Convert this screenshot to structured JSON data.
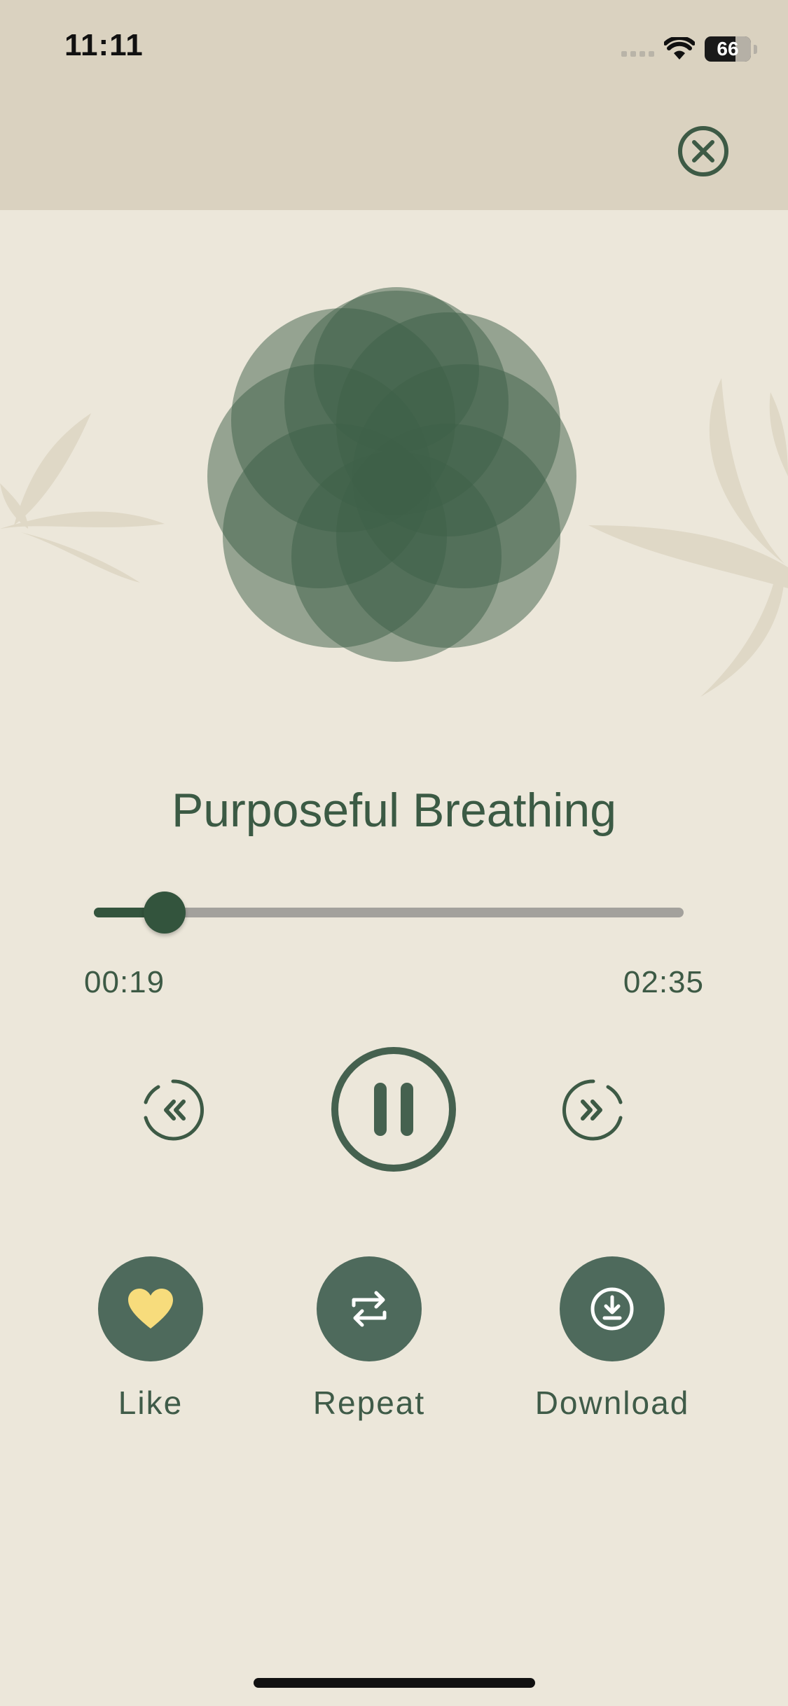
{
  "status_bar": {
    "time": "11:11",
    "battery": "66"
  },
  "player": {
    "title": "Purposeful Breathing",
    "elapsed": "00:19",
    "total": "02:35",
    "progress_fraction": 0.12,
    "state": "playing"
  },
  "actions": [
    {
      "label": "Like",
      "icon": "heart-icon"
    },
    {
      "label": "Repeat",
      "icon": "repeat-icon"
    },
    {
      "label": "Download",
      "icon": "download-icon"
    }
  ],
  "colors": {
    "accent": "#33543D",
    "header_bg": "#DAD2C0",
    "page_bg": "#ECE7DA",
    "action_bg": "#4E6A5C",
    "heart": "#F7DC7C"
  }
}
